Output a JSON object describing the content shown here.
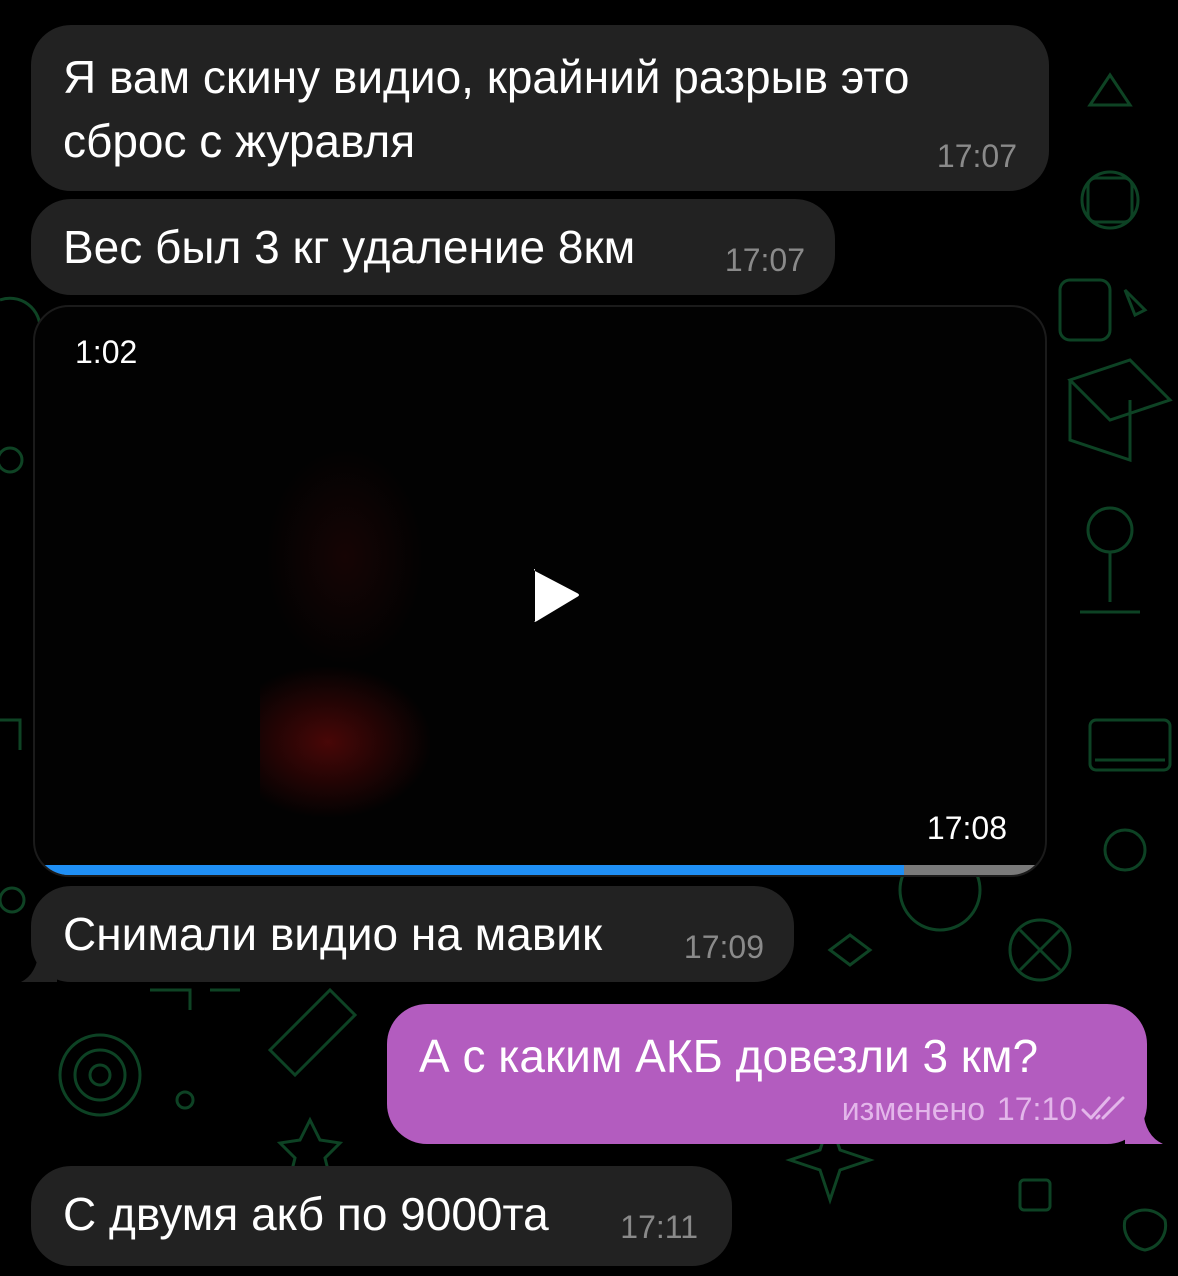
{
  "messages": [
    {
      "text": "Я вам скину видио, крайний разрыв это\nсброс с журавля",
      "time": "17:07"
    },
    {
      "text": "Вес был 3 кг удаление 8км",
      "time": "17:07"
    },
    {
      "text": "Снимали видио на мавик",
      "time": "17:09"
    },
    {
      "text": "А с каким АКБ довезли 3 км?",
      "edited_label": "изменено",
      "time": "17:10"
    },
    {
      "text": "С двумя акб по 9000та",
      "time": "17:11"
    }
  ],
  "video": {
    "duration": "1:02",
    "time": "17:08",
    "progress": 0.86
  },
  "colors": {
    "incoming_bubble": "#222222",
    "outgoing_bubble": "#b35cbf",
    "video_progress": "#1f8ff5",
    "wallpaper_doodles": "#0f4a28"
  },
  "icons": {
    "play": "play-icon",
    "read_receipt": "double-check-icon"
  }
}
